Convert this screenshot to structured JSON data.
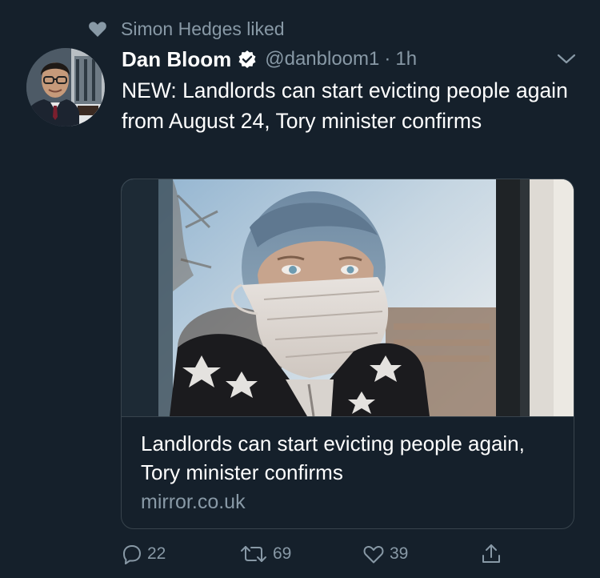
{
  "social_context": {
    "text": "Simon Hedges liked",
    "icon": "heart-icon"
  },
  "tweet": {
    "author": {
      "display_name": "Dan Bloom",
      "handle": "@danbloom1",
      "verified": true
    },
    "separator": "·",
    "time": "1h",
    "text": "NEW: Landlords can start evicting people again from August 24, Tory minister confirms",
    "card": {
      "title": "Landlords can start evicting people again, Tory minister confirms",
      "domain": "mirror.co.uk"
    },
    "actions": {
      "reply_count": "22",
      "retweet_count": "69",
      "like_count": "39"
    }
  },
  "colors": {
    "background": "#15202b",
    "secondary_text": "#8899a6",
    "border": "#38444d",
    "text": "#ffffff"
  }
}
